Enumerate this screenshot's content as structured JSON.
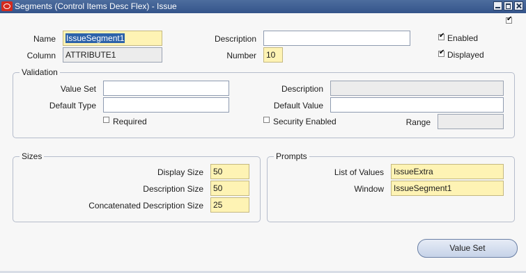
{
  "window": {
    "title": "Segments (Control Items Desc Flex) - Issue"
  },
  "header": {
    "name_label": "Name",
    "name_value": "IssueSegment1",
    "column_label": "Column",
    "column_value": "ATTRIBUTE1",
    "description_label": "Description",
    "description_value": "",
    "number_label": "Number",
    "number_value": "10",
    "enabled_label": "Enabled",
    "enabled_checked": true,
    "displayed_label": "Displayed",
    "displayed_checked": true,
    "corner_checked": true
  },
  "validation": {
    "title": "Validation",
    "value_set_label": "Value Set",
    "value_set_value": "",
    "default_type_label": "Default Type",
    "default_type_value": "",
    "description_label": "Description",
    "description_value": "",
    "default_value_label": "Default Value",
    "default_value_value": "",
    "required_label": "Required",
    "required_checked": false,
    "security_label": "Security Enabled",
    "security_checked": false,
    "range_label": "Range",
    "range_value": ""
  },
  "sizes": {
    "title": "Sizes",
    "display_size_label": "Display Size",
    "display_size_value": "50",
    "description_size_label": "Description Size",
    "description_size_value": "50",
    "concat_label": "Concatenated Description Size",
    "concat_value": "25"
  },
  "prompts": {
    "title": "Prompts",
    "lov_label": "List of Values",
    "lov_value": "IssueExtra",
    "window_label": "Window",
    "window_value": "IssueSegment1"
  },
  "buttons": {
    "value_set": "Value Set"
  }
}
